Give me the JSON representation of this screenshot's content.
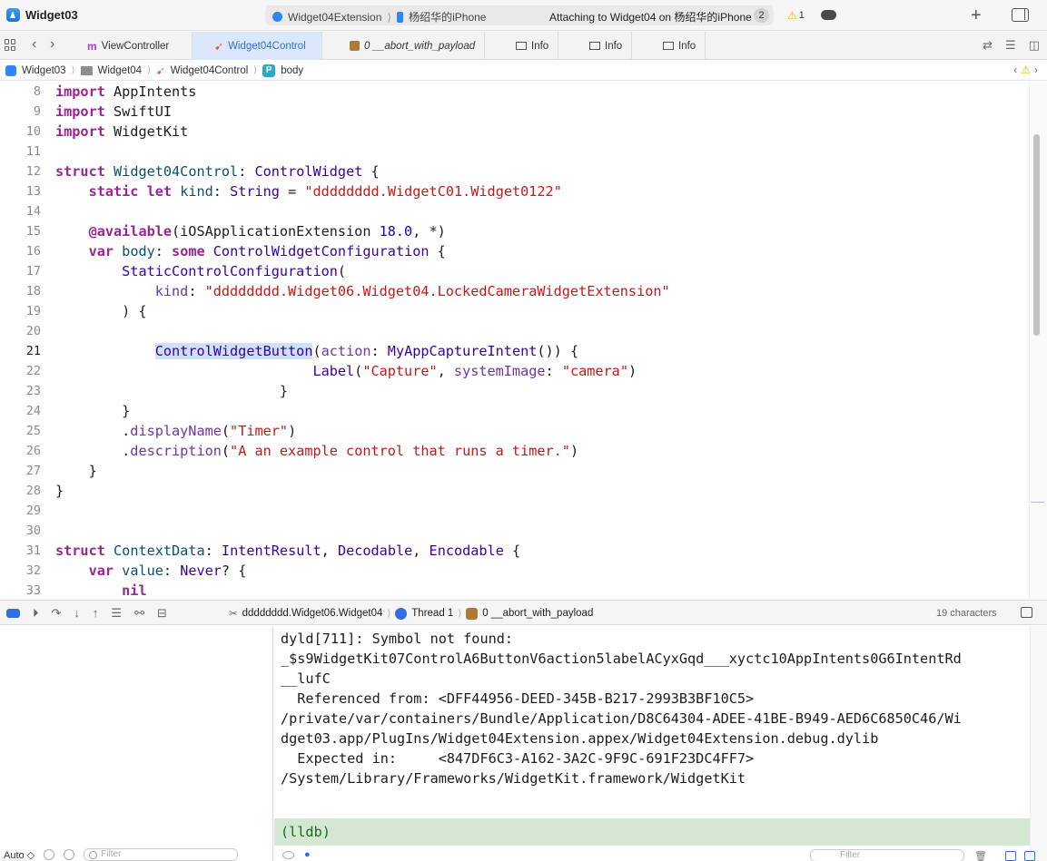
{
  "window": {
    "title": "Widget03",
    "scheme": "Widget04Extension",
    "device": "杨绍华的iPhone",
    "status_text": "Attaching to Widget04 on 杨绍华的iPhone",
    "status_count": "2",
    "warning_count": "1"
  },
  "tabs": [
    {
      "label": "ViewController",
      "icon": "m-icon",
      "active": false
    },
    {
      "label": "Widget04Control",
      "icon": "swift-icon",
      "active": true
    },
    {
      "label": "0 __abort_with_payload",
      "icon": "frame-icon",
      "active": false
    },
    {
      "label": "Info",
      "icon": "table-icon",
      "active": false
    },
    {
      "label": "Info",
      "icon": "table-icon",
      "active": false
    },
    {
      "label": "Info",
      "icon": "table-icon",
      "active": false
    }
  ],
  "breadcrumb": [
    "Widget03",
    "Widget04",
    "Widget04Control",
    "body"
  ],
  "editor": {
    "current_line": 21,
    "lines": [
      {
        "n": "8",
        "text": "import AppIntents"
      },
      {
        "n": "9",
        "text": "import SwiftUI"
      },
      {
        "n": "10",
        "text": "import WidgetKit"
      },
      {
        "n": "11",
        "text": ""
      },
      {
        "n": "12",
        "text": "struct Widget04Control: ControlWidget {"
      },
      {
        "n": "13",
        "text": "    static let kind: String = \"dddddddd.WidgetC01.Widget0122\""
      },
      {
        "n": "14",
        "text": ""
      },
      {
        "n": "15",
        "text": "    @available(iOSApplicationExtension 18.0, *)"
      },
      {
        "n": "16",
        "text": "    var body: some ControlWidgetConfiguration {"
      },
      {
        "n": "17",
        "text": "        StaticControlConfiguration("
      },
      {
        "n": "18",
        "text": "            kind: \"dddddddd.Widget06.Widget04.LockedCameraWidgetExtension\""
      },
      {
        "n": "19",
        "text": "        ) {"
      },
      {
        "n": "20",
        "text": ""
      },
      {
        "n": "21",
        "text": "            ControlWidgetButton(action: MyAppCaptureIntent()) {"
      },
      {
        "n": "22",
        "text": "                               Label(\"Capture\", systemImage: \"camera\")"
      },
      {
        "n": "23",
        "text": "                           }"
      },
      {
        "n": "24",
        "text": "        }"
      },
      {
        "n": "25",
        "text": "        .displayName(\"Timer\")"
      },
      {
        "n": "26",
        "text": "        .description(\"A an example control that runs a timer.\")"
      },
      {
        "n": "27",
        "text": "    }"
      },
      {
        "n": "28",
        "text": "}"
      },
      {
        "n": "29",
        "text": ""
      },
      {
        "n": "30",
        "text": ""
      },
      {
        "n": "31",
        "text": "struct ContextData: IntentResult, Decodable, Encodable {"
      },
      {
        "n": "32",
        "text": "    var value: Never? {"
      },
      {
        "n": "33",
        "text": "        nil"
      }
    ]
  },
  "debug_bar": {
    "target": "dddddddd.Widget06.Widget04",
    "thread": "Thread 1",
    "frame": "0 __abort_with_payload",
    "selection": "19 characters"
  },
  "console": {
    "lines": [
      "dyld[711]: Symbol not found:",
      "_$s9WidgetKit07ControlA6ButtonV6action5labelACyxGqd___xyctc10AppIntents0G6IntentRd",
      "__lufC",
      "  Referenced from: <DFF44956-DEED-345B-B217-2993B3BF10C5>",
      "/private/var/containers/Bundle/Application/D8C64304-ADEE-41BE-B949-AED6C6850C46/Wi",
      "dget03.app/PlugIns/Widget04Extension.appex/Widget04Extension.debug.dylib",
      "  Expected in:     <847DF6C3-A162-3A2C-9F9C-691F23DC4FF7>",
      "/System/Library/Frameworks/WidgetKit.framework/WidgetKit"
    ],
    "prompt": "(lldb)"
  },
  "footer": {
    "auto_label": "Auto ◇",
    "vars_filter_placeholder": "Filter",
    "console_filter_placeholder": "Filter"
  },
  "colors": {
    "keyword": "#9b2393",
    "string": "#c41a16",
    "type": "#3900a0",
    "accent": "#2f6fe0",
    "prompt_bg": "#d3e7d3"
  }
}
